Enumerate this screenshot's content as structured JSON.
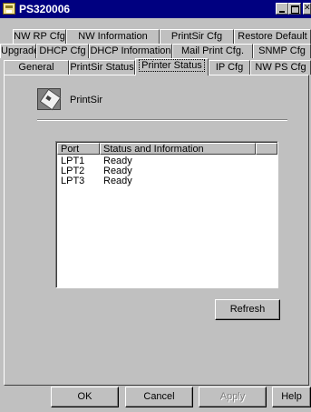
{
  "window": {
    "title": "PS320006"
  },
  "tabs": {
    "row1": [
      "NW RP Cfg",
      "NW Information",
      "PrintSir Cfg",
      "Restore Default"
    ],
    "row2": [
      "Upgrade",
      "DHCP Cfg",
      "DHCP Information",
      "Mail Print Cfg.",
      "SNMP Cfg"
    ],
    "row3": [
      "General",
      "PrintSir Status",
      "Printer Status",
      "IP Cfg",
      "NW PS Cfg"
    ],
    "active": "Printer Status"
  },
  "panel": {
    "device_name": "PrintSir",
    "list": {
      "columns": [
        "Port",
        "Status and Information"
      ],
      "rows": [
        {
          "port": "LPT1",
          "status": "Ready"
        },
        {
          "port": "LPT2",
          "status": "Ready"
        },
        {
          "port": "LPT3",
          "status": "Ready"
        }
      ]
    },
    "refresh_label": "Refresh"
  },
  "buttons": {
    "ok": "OK",
    "cancel": "Cancel",
    "apply": "Apply",
    "help": "Help"
  },
  "icons": [
    "app-icon",
    "minimize-icon",
    "maximize-icon",
    "close-icon",
    "printer-server-icon"
  ],
  "colors": {
    "titlebar": "#000080",
    "face": "#c0c0c0"
  }
}
